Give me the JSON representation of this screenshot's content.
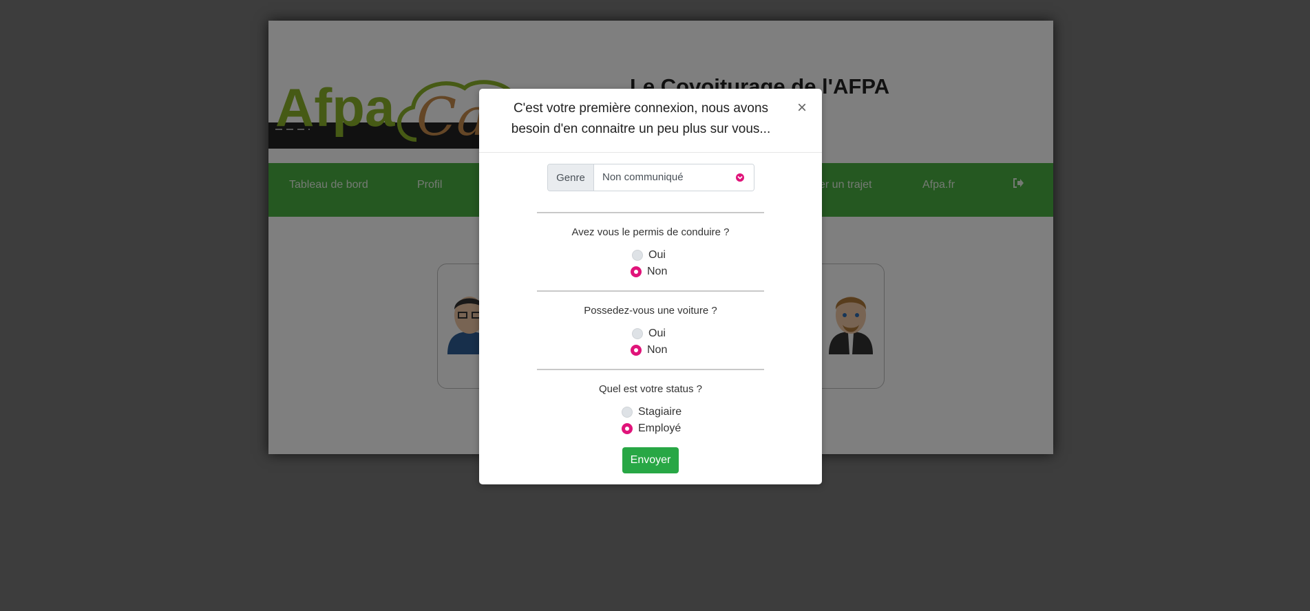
{
  "header": {
    "title": "Le Covoiturage de l'AFPA",
    "logo_text_1": "Afpa",
    "logo_text_2": "Car"
  },
  "nav": {
    "items": [
      {
        "label": "Tableau de bord"
      },
      {
        "label": "Profil"
      },
      {
        "label": "er un trajet"
      },
      {
        "label": "Afpa.fr"
      }
    ],
    "logout_icon": "sign-out-icon"
  },
  "modal": {
    "title": "C'est votre première connexion, nous avons besoin d'en connaitre un peu plus sur vous...",
    "close_symbol": "×",
    "genre": {
      "prepend_label": "Genre",
      "selected_value": "Non communiqué"
    },
    "questions": [
      {
        "label": "Avez vous le permis de conduire ?",
        "options": [
          {
            "label": "Oui",
            "checked": false
          },
          {
            "label": "Non",
            "checked": true
          }
        ]
      },
      {
        "label": "Possedez-vous une voiture ?",
        "options": [
          {
            "label": "Oui",
            "checked": false
          },
          {
            "label": "Non",
            "checked": true
          }
        ]
      },
      {
        "label": "Quel est votre status ?",
        "options": [
          {
            "label": "Stagiaire",
            "checked": false
          },
          {
            "label": "Employé",
            "checked": true
          }
        ]
      }
    ],
    "submit_label": "Envoyer"
  },
  "colors": {
    "navbar": "#4bb043",
    "accent_radio": "#e0147a",
    "submit": "#28a745",
    "logo_green": "#8db52b",
    "logo_orange": "#c98d4c"
  }
}
